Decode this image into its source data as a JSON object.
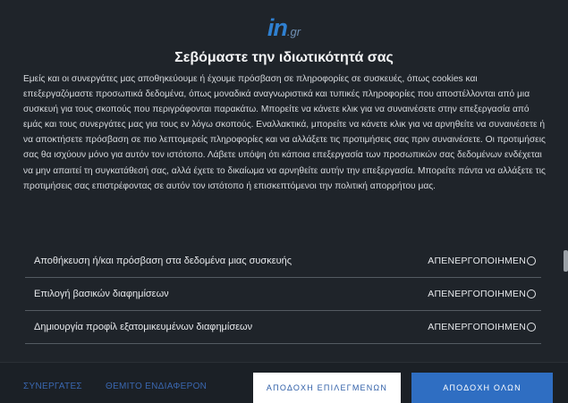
{
  "logo": {
    "main": "in",
    "tld": ".gr"
  },
  "title": "Σεβόμαστε την ιδιωτικότητά σας",
  "description": "Εμείς και οι συνεργάτες μας αποθηκεύουμε ή έχουμε πρόσβαση σε πληροφορίες σε συσκευές, όπως cookies και επεξεργαζόμαστε προσωπικά δεδομένα, όπως μοναδικά αναγνωριστικά και τυπικές πληροφορίες που αποστέλλονται από μια συσκευή για τους σκοπούς που περιγράφονται παρακάτω. Μπορείτε να κάνετε κλικ για να συναινέσετε στην επεξεργασία από εμάς και τους συνεργάτες μας για τους εν λόγω σκοπούς. Εναλλακτικά, μπορείτε να κάνετε κλικ για να αρνηθείτε να συναινέσετε ή να αποκτήσετε πρόσβαση σε πιο λεπτομερείς πληροφορίες και να αλλάξετε τις προτιμήσεις σας πριν συναινέσετε. Οι προτιμήσεις σας θα ισχύουν μόνο για αυτόν τον ιστότοπο. Λάβετε υπόψη ότι κάποια επεξεργασία των προσωπικών σας δεδομένων ενδέχεται να μην απαιτεί τη συγκατάθεσή σας, αλλά έχετε το δικαίωμα να αρνηθείτε αυτήν την επεξεργασία. Μπορείτε πάντα να αλλάξετε τις προτιμήσεις σας επιστρέφοντας σε αυτόν τον ιστότοπο ή επισκεπτόμενοι την πολιτική απορρήτου μας.",
  "options": [
    {
      "label": "Αποθήκευση ή/και πρόσβαση στα δεδομένα μιας συσκευής",
      "status": "ΑΠΕΝΕΡΓΟΠΟΙΗΜΕΝ"
    },
    {
      "label": "Επιλογή βασικών διαφημίσεων",
      "status": "ΑΠΕΝΕΡΓΟΠΟΙΗΜΕΝ"
    },
    {
      "label": "Δημιουργία προφίλ εξατομικευμένων διαφημίσεων",
      "status": "ΑΠΕΝΕΡΓΟΠΟΙΗΜΕΝ"
    }
  ],
  "footer": {
    "partners_link": "ΣΥΝΕΡΓΑΤΕΣ",
    "legit_interest_link": "ΘΕΜΙΤΟ ΕΝΔΙΑΦΕΡΟΝ",
    "accept_selected": "ΑΠΟΔΟΧΗ ΕΠΙΛΕΓΜΕΝΩΝ",
    "accept_all": "ΑΠΟΔΟΧΗ ΟΛΩΝ"
  },
  "colors": {
    "background": "#1f242a",
    "accent": "#2f6ec2",
    "link": "#3a67b0"
  }
}
